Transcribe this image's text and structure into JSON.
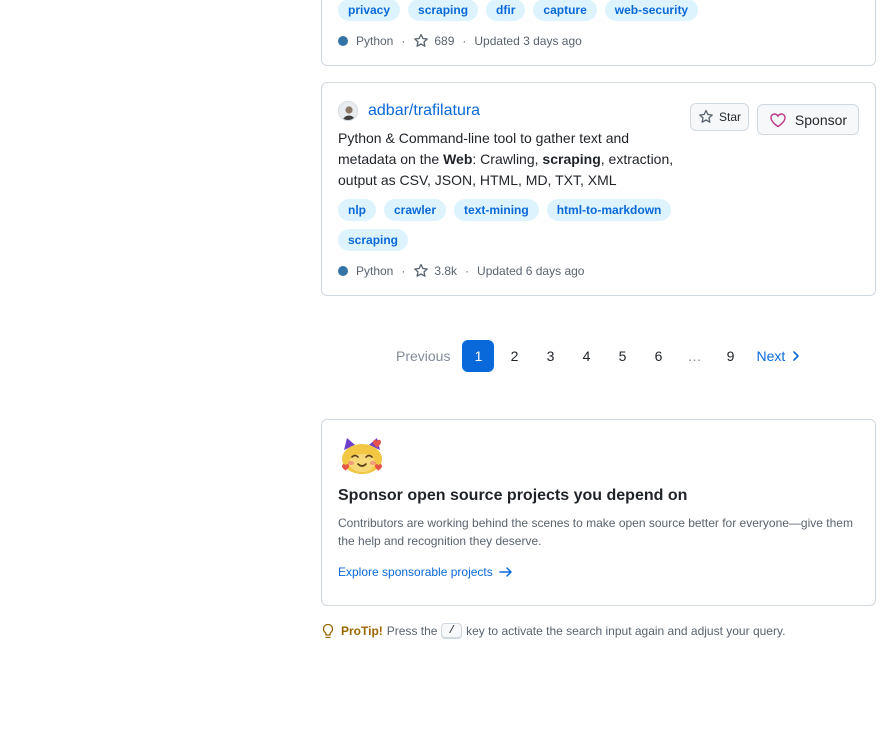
{
  "results": [
    {
      "topics": [
        "privacy",
        "scraping",
        "dfir",
        "capture",
        "web-security"
      ],
      "language": "Python",
      "language_color": "#3572A5",
      "stars": "689",
      "updated": "Updated 3 days ago"
    },
    {
      "repo": "adbar/trafilatura",
      "description_parts": [
        "Python & Command-line tool to gather text and metadata on the ",
        "Web",
        ": Crawling, ",
        "scraping",
        ", extraction, output as CSV, JSON, HTML, MD, TXT, XML"
      ],
      "star_label": "Star",
      "sponsor_label": "Sponsor",
      "topics": [
        "nlp",
        "crawler",
        "text-mining",
        "html-to-markdown",
        "scraping"
      ],
      "language": "Python",
      "language_color": "#3572A5",
      "stars": "3.8k",
      "updated": "Updated 6 days ago"
    }
  ],
  "pagination": {
    "previous": "Previous",
    "pages": [
      "1",
      "2",
      "3",
      "4",
      "5",
      "6"
    ],
    "gap": "…",
    "last": "9",
    "next": "Next",
    "current": "1"
  },
  "sponsor_promo": {
    "title": "Sponsor open source projects you depend on",
    "text": "Contributors are working behind the scenes to make open source better for everyone—give them the help and recognition they deserve.",
    "link": "Explore sponsorable projects"
  },
  "protip": {
    "label": "ProTip!",
    "before": "Press the",
    "key": "/",
    "after": "key to activate the search input again and adjust your query."
  },
  "colors": {
    "accent": "#0969da",
    "topic_bg": "#ddf4ff",
    "sponsor_heart": "#bf3989",
    "tip": "#9a6700"
  }
}
